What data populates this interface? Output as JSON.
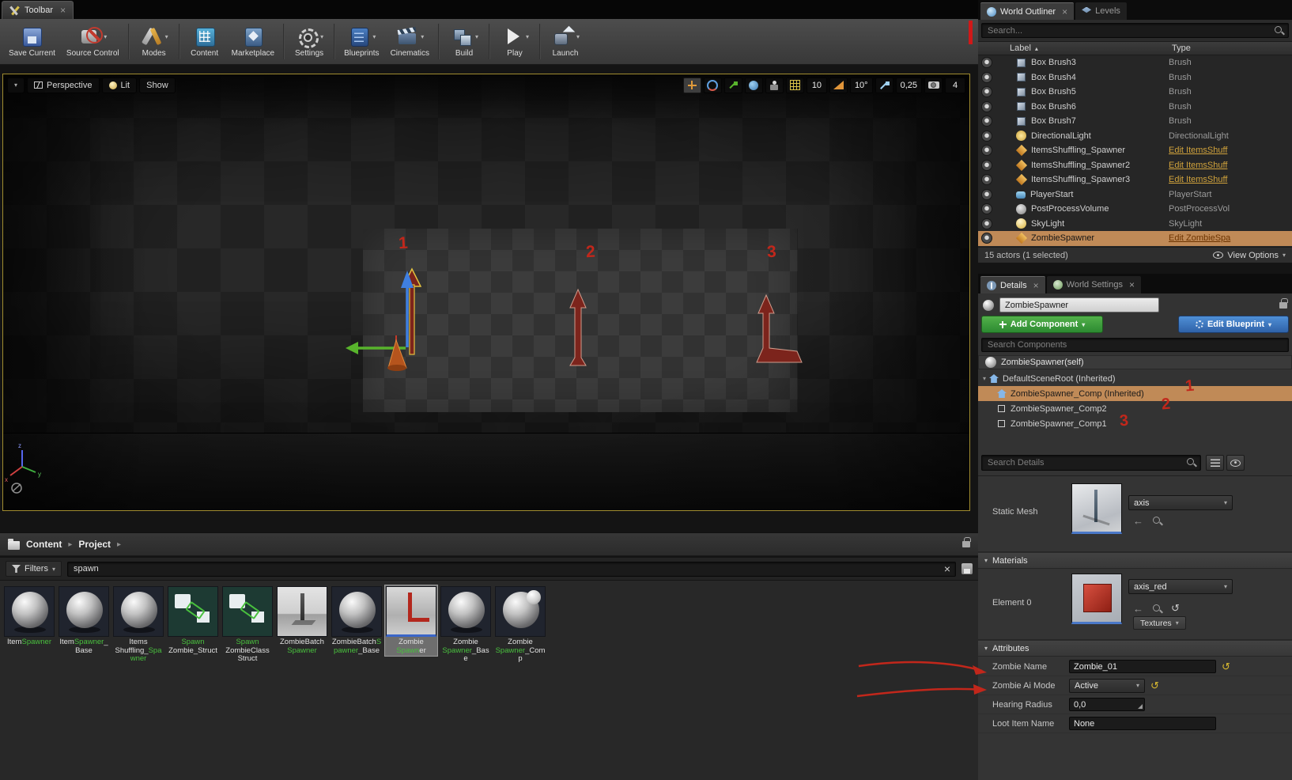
{
  "colors": {
    "selection": "#c08a57",
    "green_button": "#3fa03a",
    "blue_button": "#3c77c2",
    "edit_link": "#d1a33c",
    "search_highlight": "#49c03e",
    "annotation": "#c2271b"
  },
  "window_tab": {
    "label": "Toolbar"
  },
  "toolbar": {
    "items": [
      {
        "label": "Save Current",
        "icon": "save",
        "arrow": false
      },
      {
        "label": "Source Control",
        "icon": "source",
        "arrow": true
      },
      {
        "sep": true
      },
      {
        "label": "Modes",
        "icon": "modes",
        "arrow": true
      },
      {
        "sep": true
      },
      {
        "label": "Content",
        "icon": "content",
        "arrow": false
      },
      {
        "label": "Marketplace",
        "icon": "marketplace",
        "arrow": false
      },
      {
        "sep": true
      },
      {
        "label": "Settings",
        "icon": "settings",
        "arrow": true
      },
      {
        "sep": true
      },
      {
        "label": "Blueprints",
        "icon": "blueprints",
        "arrow": true
      },
      {
        "label": "Cinematics",
        "icon": "cinematics",
        "arrow": true
      },
      {
        "sep": true
      },
      {
        "label": "Build",
        "icon": "build",
        "arrow": true
      },
      {
        "sep": true
      },
      {
        "label": "Play",
        "icon": "play",
        "arrow": true
      },
      {
        "sep": true
      },
      {
        "label": "Launch",
        "icon": "launch",
        "arrow": true
      }
    ]
  },
  "viewport": {
    "perspective_label": "Perspective",
    "lit_label": "Lit",
    "show_label": "Show",
    "snap_grid": "10",
    "snap_angle": "10°",
    "snap_scale": "0,25",
    "camera_speed": "4",
    "markers": [
      "1",
      "2",
      "3"
    ],
    "axis_labels": {
      "x": "x",
      "y": "y",
      "z": "z"
    }
  },
  "content_browser": {
    "breadcrumb_root": "Content",
    "breadcrumb_path": "Project",
    "filters_label": "Filters",
    "search_value": "spawn",
    "assets": [
      {
        "thumb": "sphere",
        "selected": false,
        "name": [
          {
            "t": "Item",
            "g": false
          },
          {
            "t": "Spawner",
            "g": true
          }
        ]
      },
      {
        "thumb": "sphere",
        "selected": false,
        "name": [
          {
            "t": "Item",
            "g": false
          },
          {
            "t": "Spawner",
            "g": true
          },
          {
            "t": "_Base",
            "g": false
          }
        ]
      },
      {
        "thumb": "sphere",
        "selected": false,
        "name": [
          {
            "t": "Items Shuffling_",
            "g": false
          },
          {
            "t": "Spawner",
            "g": true
          }
        ]
      },
      {
        "thumb": "struct",
        "selected": false,
        "name": [
          {
            "t": "Spawn",
            "g": true
          },
          {
            "t": " Zombie_Struct",
            "g": false
          }
        ]
      },
      {
        "thumb": "struct",
        "selected": false,
        "name": [
          {
            "t": "Spawn",
            "g": true
          },
          {
            "t": " ZombieClass Struct",
            "g": false
          }
        ]
      },
      {
        "thumb": "scene",
        "selected": false,
        "name": [
          {
            "t": "ZombieBatch ",
            "g": false
          },
          {
            "t": "Spawner",
            "g": true
          }
        ]
      },
      {
        "thumb": "sphere",
        "selected": false,
        "name": [
          {
            "t": "ZombieBatch",
            "g": false
          },
          {
            "t": "Spawner",
            "g": true
          },
          {
            "t": "_Base",
            "g": false
          }
        ]
      },
      {
        "thumb": "axis",
        "selected": true,
        "name": [
          {
            "t": "Zombie ",
            "g": false
          },
          {
            "t": "Spawn",
            "g": true
          },
          {
            "t": "er",
            "g": false
          }
        ]
      },
      {
        "thumb": "sphere",
        "selected": false,
        "name": [
          {
            "t": "Zombie ",
            "g": false
          },
          {
            "t": "Spawner",
            "g": true
          },
          {
            "t": "_Base",
            "g": false
          }
        ]
      },
      {
        "thumb": "sphere2",
        "selected": false,
        "name": [
          {
            "t": "Zombie ",
            "g": false
          },
          {
            "t": "Spawner",
            "g": true
          },
          {
            "t": "_Comp",
            "g": false
          }
        ]
      }
    ]
  },
  "outliner": {
    "tab_world_outliner": "World Outliner",
    "tab_levels": "Levels",
    "search_placeholder": "Search...",
    "col_label": "Label",
    "col_type": "Type",
    "rows": [
      {
        "icon": "brush",
        "label": "Box Brush3",
        "type": "Brush"
      },
      {
        "icon": "brush",
        "label": "Box Brush4",
        "type": "Brush"
      },
      {
        "icon": "brush",
        "label": "Box Brush5",
        "type": "Brush"
      },
      {
        "icon": "brush",
        "label": "Box Brush6",
        "type": "Brush"
      },
      {
        "icon": "brush",
        "label": "Box Brush7",
        "type": "Brush"
      },
      {
        "icon": "dirlight",
        "label": "DirectionalLight",
        "type": "DirectionalLight"
      },
      {
        "icon": "bp",
        "label": "ItemsShuffling_Spawner",
        "type": "Edit ItemsShuff",
        "link": true
      },
      {
        "icon": "bp",
        "label": "ItemsShuffling_Spawner2",
        "type": "Edit ItemsShuff",
        "link": true
      },
      {
        "icon": "bp",
        "label": "ItemsShuffling_Spawner3",
        "type": "Edit ItemsShuff",
        "link": true
      },
      {
        "icon": "player",
        "label": "PlayerStart",
        "type": "PlayerStart"
      },
      {
        "icon": "ppv",
        "label": "PostProcessVolume",
        "type": "PostProcessVol"
      },
      {
        "icon": "skylight",
        "label": "SkyLight",
        "type": "SkyLight"
      },
      {
        "icon": "bp",
        "label": "ZombieSpawner",
        "type": "Edit ZombieSpa",
        "link": true,
        "selected": true
      }
    ],
    "footer": "15 actors (1 selected)",
    "view_options_label": "View Options"
  },
  "details": {
    "tab_details": "Details",
    "tab_world_settings": "World Settings",
    "actor_name": "ZombieSpawner",
    "add_component_label": "Add Component",
    "edit_blueprint_label": "Edit Blueprint",
    "search_components_placeholder": "Search Components",
    "self_label": "ZombieSpawner(self)",
    "components": [
      {
        "icon": "root",
        "label": "DefaultSceneRoot (Inherited)",
        "depth": 0,
        "selected": false,
        "badge": ""
      },
      {
        "icon": "root",
        "label": "ZombieSpawner_Comp (Inherited)",
        "depth": 1,
        "selected": true,
        "badge": "1"
      },
      {
        "icon": "comp",
        "label": "ZombieSpawner_Comp2",
        "depth": 1,
        "selected": false,
        "badge": "2"
      },
      {
        "icon": "comp",
        "label": "ZombieSpawner_Comp1",
        "depth": 1,
        "selected": false,
        "badge": "3"
      }
    ],
    "search_details_placeholder": "Search Details",
    "properties": {
      "static_mesh_label": "Static Mesh",
      "static_mesh_value": "axis",
      "materials_header": "Materials",
      "element0_label": "Element 0",
      "element0_value": "axis_red",
      "textures_label": "Textures",
      "attributes_header": "Attributes",
      "rows": [
        {
          "label": "Zombie Name",
          "value": "Zombie_01",
          "widget": "text",
          "reset": true
        },
        {
          "label": "Zombie Ai Mode",
          "value": "Active",
          "widget": "select",
          "reset": true
        },
        {
          "label": "Hearing Radius",
          "value": "0,0",
          "widget": "number",
          "reset": false
        },
        {
          "label": "Loot Item Name",
          "value": "None",
          "widget": "text",
          "reset": false
        }
      ]
    }
  }
}
